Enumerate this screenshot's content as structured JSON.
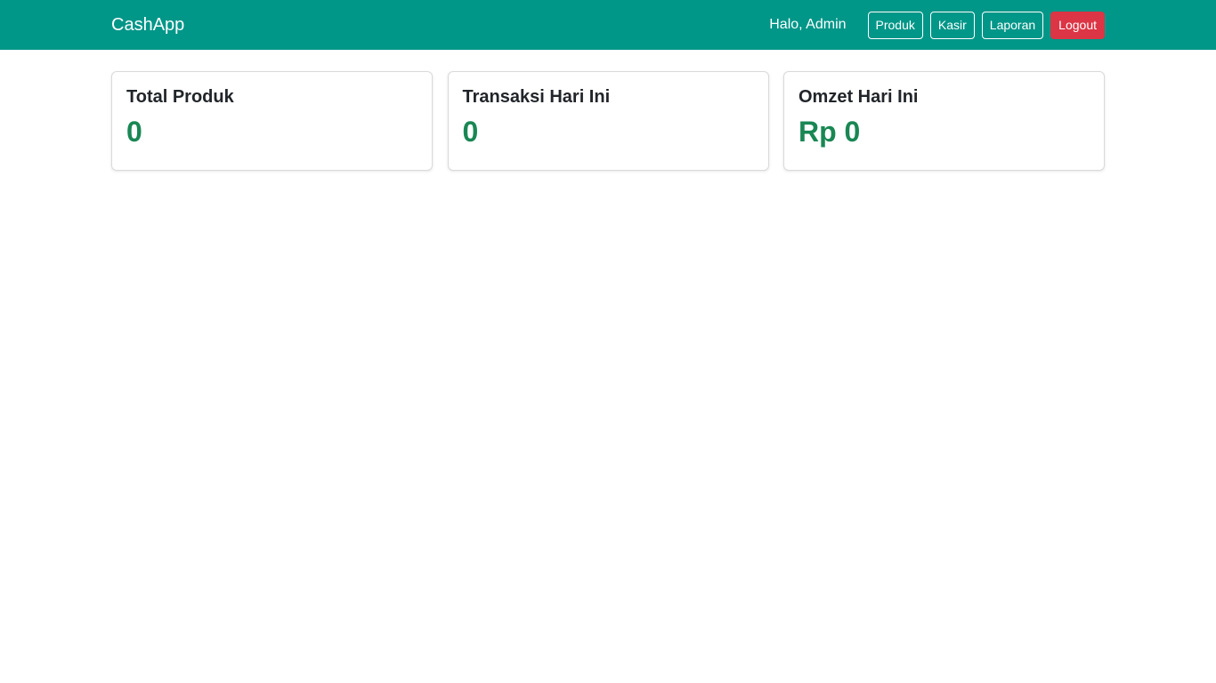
{
  "navbar": {
    "brand": "CashApp",
    "greeting": "Halo, Admin",
    "buttons": [
      {
        "label": "Produk"
      },
      {
        "label": "Kasir"
      },
      {
        "label": "Laporan"
      },
      {
        "label": "Logout"
      }
    ],
    "background_color": "#009688",
    "logout_color": "#dc3545"
  },
  "stats": [
    {
      "title": "Total Produk",
      "value": "0"
    },
    {
      "title": "Transaksi Hari Ini",
      "value": "0"
    },
    {
      "title": "Omzet Hari Ini",
      "value": "Rp 0"
    }
  ],
  "accent_value_color": "#198754"
}
